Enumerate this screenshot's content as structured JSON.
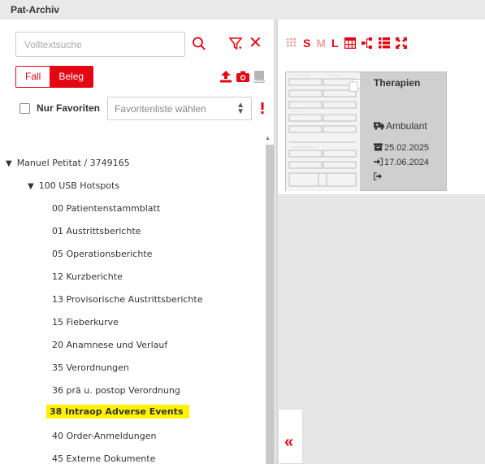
{
  "window": {
    "title": "Pat-Archiv"
  },
  "search": {
    "placeholder": "Volltextsuche",
    "value": ""
  },
  "toggle": {
    "fall_label": "Fall",
    "beleg_label": "Beleg",
    "active": "Beleg"
  },
  "favorites": {
    "checkbox_label": "Nur Favoriten",
    "checked": false,
    "select_placeholder": "Favoritenliste wählen"
  },
  "tree": {
    "patient": "Manuel Petitat / 3749165",
    "group": "100 USB Hotspots",
    "items": [
      "00 Patientenstammblatt",
      "01 Austrittsberichte",
      "05 Operationsberichte",
      "12 Kurzberichte",
      "13 Provisorische Austrittsberichte",
      "15 Fieberkurve",
      "20 Anamnese und Verlauf",
      "35 Verordnungen",
      "36 prä u. postop Verordnung",
      "38 Intraop Adverse Events",
      "40 Order-Anmeldungen",
      "45 Externe Dokumente"
    ],
    "selected": "38 Intraop Adverse Events"
  },
  "view_toolbar": {
    "size_s": "S",
    "size_m": "M",
    "size_l": "L",
    "icons": [
      "grid-view-icon",
      "table-view-icon",
      "hierarchy-icon",
      "list-view-icon",
      "fullscreen-icon"
    ]
  },
  "document_card": {
    "title": "Therapien",
    "case_type": "Ambulant",
    "date_document": "25.02.2025",
    "date_admission": "17.06.2024",
    "date_discharge": ""
  },
  "colors": {
    "accent": "#e30613",
    "highlight": "#fff200",
    "panel_bg": "#e6e6e6"
  }
}
